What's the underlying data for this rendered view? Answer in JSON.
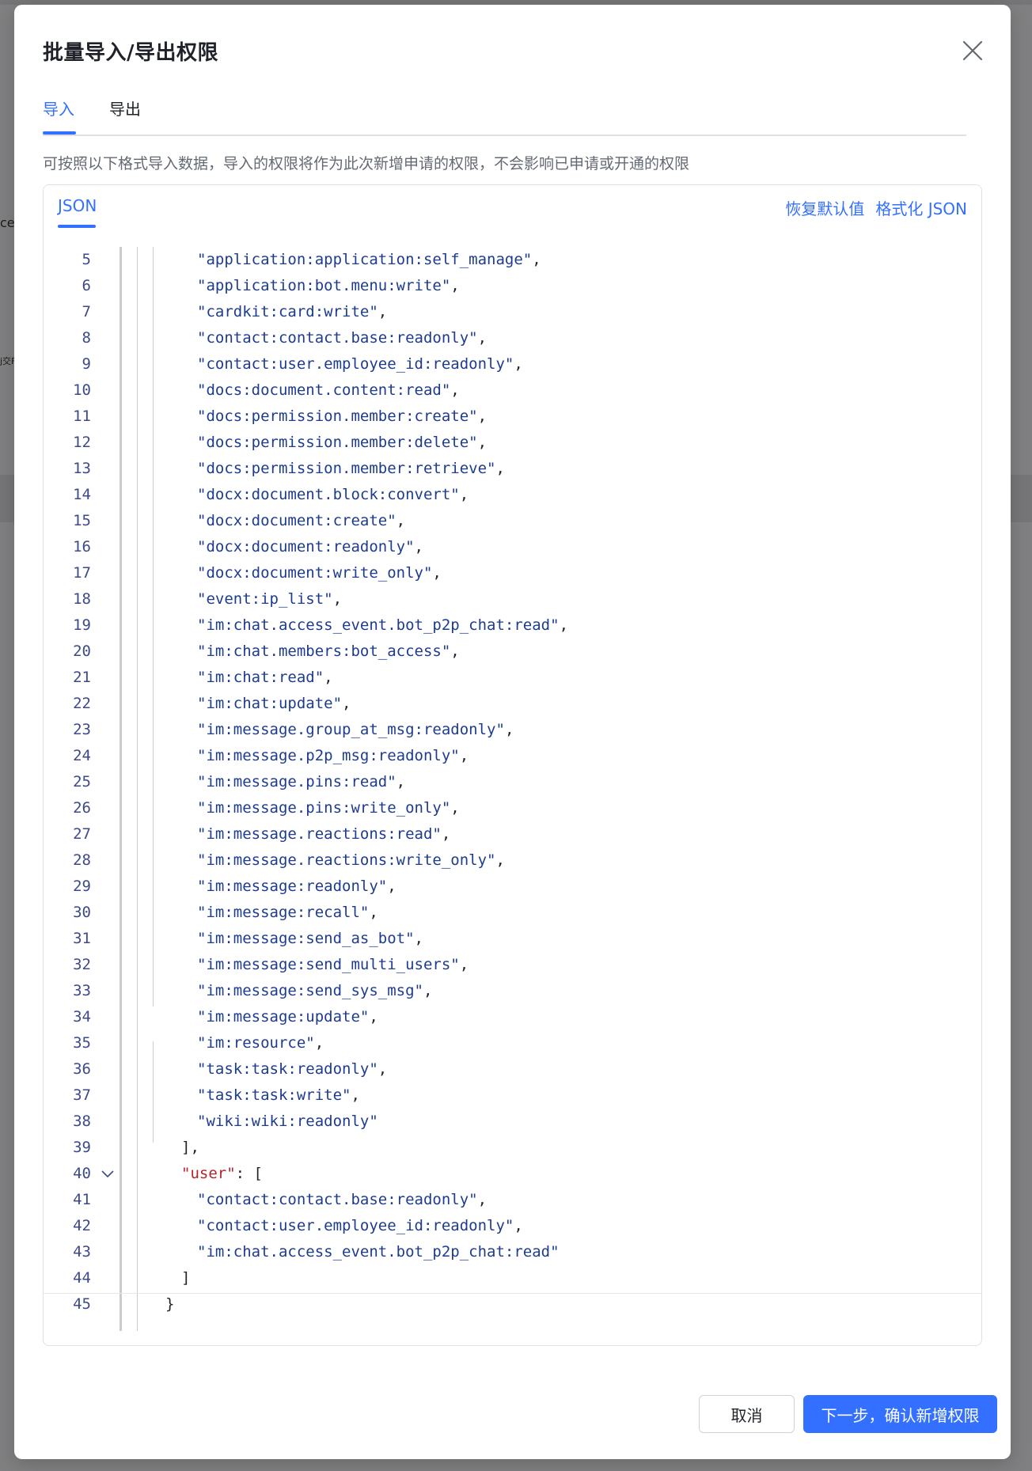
{
  "modal": {
    "title": "批量导入/导出权限",
    "tabs": [
      {
        "label": "导入",
        "active": true
      },
      {
        "label": "导出",
        "active": false
      }
    ],
    "hint": "可按照以下格式导入数据，导入的权限将作为此次新增申请的权限，不会影响已申请或开通的权限",
    "editor": {
      "tab_label": "JSON",
      "restore_label": "恢复默认值",
      "format_label": "格式化 JSON",
      "lines": [
        {
          "n": "5",
          "indent": 2,
          "text": "\"application:application:self_manage\"",
          "tail": ","
        },
        {
          "n": "6",
          "indent": 2,
          "text": "\"application:bot.menu:write\"",
          "tail": ","
        },
        {
          "n": "7",
          "indent": 2,
          "text": "\"cardkit:card:write\"",
          "tail": ","
        },
        {
          "n": "8",
          "indent": 2,
          "text": "\"contact:contact.base:readonly\"",
          "tail": ","
        },
        {
          "n": "9",
          "indent": 2,
          "text": "\"contact:user.employee_id:readonly\"",
          "tail": ","
        },
        {
          "n": "10",
          "indent": 2,
          "text": "\"docs:document.content:read\"",
          "tail": ","
        },
        {
          "n": "11",
          "indent": 2,
          "text": "\"docs:permission.member:create\"",
          "tail": ","
        },
        {
          "n": "12",
          "indent": 2,
          "text": "\"docs:permission.member:delete\"",
          "tail": ","
        },
        {
          "n": "13",
          "indent": 2,
          "text": "\"docs:permission.member:retrieve\"",
          "tail": ","
        },
        {
          "n": "14",
          "indent": 2,
          "text": "\"docx:document.block:convert\"",
          "tail": ","
        },
        {
          "n": "15",
          "indent": 2,
          "text": "\"docx:document:create\"",
          "tail": ","
        },
        {
          "n": "16",
          "indent": 2,
          "text": "\"docx:document:readonly\"",
          "tail": ","
        },
        {
          "n": "17",
          "indent": 2,
          "text": "\"docx:document:write_only\"",
          "tail": ","
        },
        {
          "n": "18",
          "indent": 2,
          "text": "\"event:ip_list\"",
          "tail": ","
        },
        {
          "n": "19",
          "indent": 2,
          "text": "\"im:chat.access_event.bot_p2p_chat:read\"",
          "tail": ","
        },
        {
          "n": "20",
          "indent": 2,
          "text": "\"im:chat.members:bot_access\"",
          "tail": ","
        },
        {
          "n": "21",
          "indent": 2,
          "text": "\"im:chat:read\"",
          "tail": ","
        },
        {
          "n": "22",
          "indent": 2,
          "text": "\"im:chat:update\"",
          "tail": ","
        },
        {
          "n": "23",
          "indent": 2,
          "text": "\"im:message.group_at_msg:readonly\"",
          "tail": ","
        },
        {
          "n": "24",
          "indent": 2,
          "text": "\"im:message.p2p_msg:readonly\"",
          "tail": ","
        },
        {
          "n": "25",
          "indent": 2,
          "text": "\"im:message.pins:read\"",
          "tail": ","
        },
        {
          "n": "26",
          "indent": 2,
          "text": "\"im:message.pins:write_only\"",
          "tail": ","
        },
        {
          "n": "27",
          "indent": 2,
          "text": "\"im:message.reactions:read\"",
          "tail": ","
        },
        {
          "n": "28",
          "indent": 2,
          "text": "\"im:message.reactions:write_only\"",
          "tail": ","
        },
        {
          "n": "29",
          "indent": 2,
          "text": "\"im:message:readonly\"",
          "tail": ","
        },
        {
          "n": "30",
          "indent": 2,
          "text": "\"im:message:recall\"",
          "tail": ","
        },
        {
          "n": "31",
          "indent": 2,
          "text": "\"im:message:send_as_bot\"",
          "tail": ","
        },
        {
          "n": "32",
          "indent": 2,
          "text": "\"im:message:send_multi_users\"",
          "tail": ","
        },
        {
          "n": "33",
          "indent": 2,
          "text": "\"im:message:send_sys_msg\"",
          "tail": ","
        },
        {
          "n": "34",
          "indent": 2,
          "text": "\"im:message:update\"",
          "tail": ","
        },
        {
          "n": "35",
          "indent": 2,
          "text": "\"im:resource\"",
          "tail": ","
        },
        {
          "n": "36",
          "indent": 2,
          "text": "\"task:task:readonly\"",
          "tail": ","
        },
        {
          "n": "37",
          "indent": 2,
          "text": "\"task:task:write\"",
          "tail": ","
        },
        {
          "n": "38",
          "indent": 2,
          "text": "\"wiki:wiki:readonly\"",
          "tail": ""
        },
        {
          "n": "39",
          "indent": 1,
          "text": "],",
          "tail": "",
          "plain": true
        },
        {
          "n": "40",
          "indent": 1,
          "text": "\"user\"",
          "tail": ": [",
          "key": true,
          "fold": true
        },
        {
          "n": "41",
          "indent": 2,
          "text": "\"contact:contact.base:readonly\"",
          "tail": ","
        },
        {
          "n": "42",
          "indent": 2,
          "text": "\"contact:user.employee_id:readonly\"",
          "tail": ","
        },
        {
          "n": "43",
          "indent": 2,
          "text": "\"im:chat.access_event.bot_p2p_chat:read\"",
          "tail": ""
        },
        {
          "n": "44",
          "indent": 1,
          "text": "]",
          "tail": "",
          "plain": true
        },
        {
          "n": "45",
          "indent": 0,
          "text": "}",
          "tail": "",
          "plain": true
        }
      ]
    },
    "buttons": {
      "cancel": "取消",
      "next": "下一步，确认新增权限"
    }
  },
  "background": {
    "side_text_1": "ce",
    "side_text_2": "j交F"
  },
  "colors": {
    "accent": "#3370ff",
    "json_string": "#1d3c8f",
    "json_key": "#b2232a"
  }
}
